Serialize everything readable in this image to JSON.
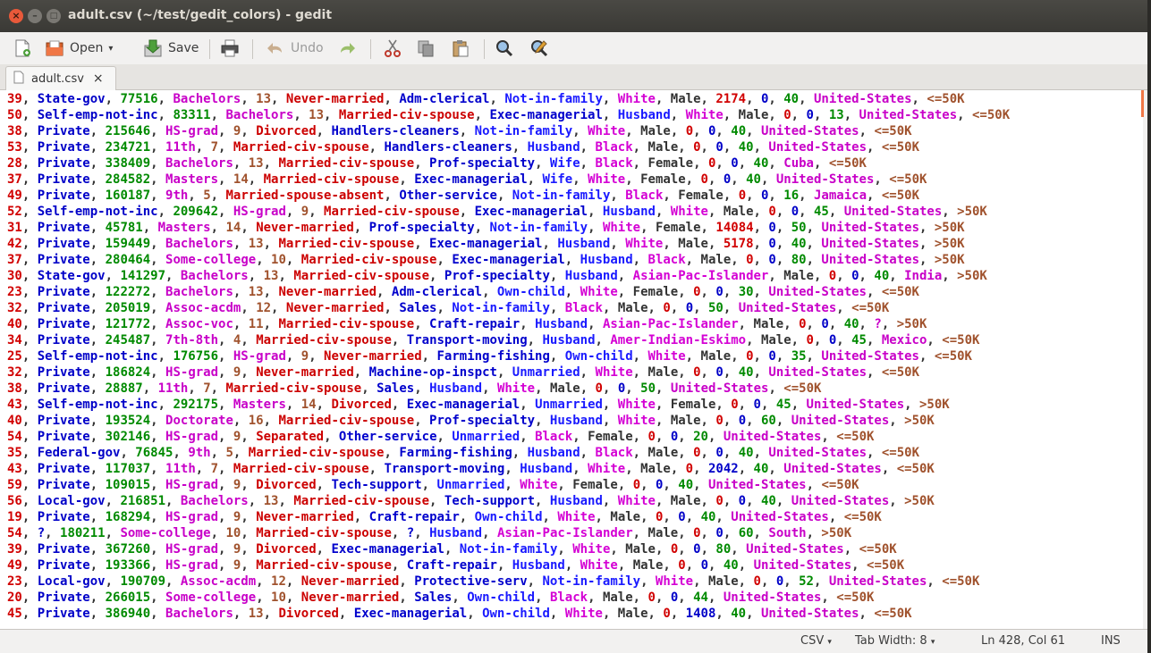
{
  "window": {
    "title": "adult.csv (~/test/gedit_colors) - gedit"
  },
  "toolbar": {
    "open_label": "Open",
    "save_label": "Save",
    "undo_label": "Undo"
  },
  "tabs": [
    {
      "label": "adult.csv"
    }
  ],
  "status": {
    "language": "CSV",
    "tab_width": "Tab Width: 8",
    "position": "Ln 428, Col 61",
    "mode": "INS"
  },
  "colors": {
    "c0": "#d10000",
    "c1": "#0000c8",
    "c2": "#008a00",
    "c3": "#c800c8",
    "c4": "#a0522d",
    "c5": "#cc0000",
    "c6": "#0000cc",
    "c7": "#1a1aff",
    "c8": "#d400d4",
    "c9": "#333333"
  },
  "lines": [
    "39, State-gov, 77516, Bachelors, 13, Never-married, Adm-clerical, Not-in-family, White, Male, 2174, 0, 40, United-States, <=50K",
    "50, Self-emp-not-inc, 83311, Bachelors, 13, Married-civ-spouse, Exec-managerial, Husband, White, Male, 0, 0, 13, United-States, <=50K",
    "38, Private, 215646, HS-grad, 9, Divorced, Handlers-cleaners, Not-in-family, White, Male, 0, 0, 40, United-States, <=50K",
    "53, Private, 234721, 11th, 7, Married-civ-spouse, Handlers-cleaners, Husband, Black, Male, 0, 0, 40, United-States, <=50K",
    "28, Private, 338409, Bachelors, 13, Married-civ-spouse, Prof-specialty, Wife, Black, Female, 0, 0, 40, Cuba, <=50K",
    "37, Private, 284582, Masters, 14, Married-civ-spouse, Exec-managerial, Wife, White, Female, 0, 0, 40, United-States, <=50K",
    "49, Private, 160187, 9th, 5, Married-spouse-absent, Other-service, Not-in-family, Black, Female, 0, 0, 16, Jamaica, <=50K",
    "52, Self-emp-not-inc, 209642, HS-grad, 9, Married-civ-spouse, Exec-managerial, Husband, White, Male, 0, 0, 45, United-States, >50K",
    "31, Private, 45781, Masters, 14, Never-married, Prof-specialty, Not-in-family, White, Female, 14084, 0, 50, United-States, >50K",
    "42, Private, 159449, Bachelors, 13, Married-civ-spouse, Exec-managerial, Husband, White, Male, 5178, 0, 40, United-States, >50K",
    "37, Private, 280464, Some-college, 10, Married-civ-spouse, Exec-managerial, Husband, Black, Male, 0, 0, 80, United-States, >50K",
    "30, State-gov, 141297, Bachelors, 13, Married-civ-spouse, Prof-specialty, Husband, Asian-Pac-Islander, Male, 0, 0, 40, India, >50K",
    "23, Private, 122272, Bachelors, 13, Never-married, Adm-clerical, Own-child, White, Female, 0, 0, 30, United-States, <=50K",
    "32, Private, 205019, Assoc-acdm, 12, Never-married, Sales, Not-in-family, Black, Male, 0, 0, 50, United-States, <=50K",
    "40, Private, 121772, Assoc-voc, 11, Married-civ-spouse, Craft-repair, Husband, Asian-Pac-Islander, Male, 0, 0, 40, ?, >50K",
    "34, Private, 245487, 7th-8th, 4, Married-civ-spouse, Transport-moving, Husband, Amer-Indian-Eskimo, Male, 0, 0, 45, Mexico, <=50K",
    "25, Self-emp-not-inc, 176756, HS-grad, 9, Never-married, Farming-fishing, Own-child, White, Male, 0, 0, 35, United-States, <=50K",
    "32, Private, 186824, HS-grad, 9, Never-married, Machine-op-inspct, Unmarried, White, Male, 0, 0, 40, United-States, <=50K",
    "38, Private, 28887, 11th, 7, Married-civ-spouse, Sales, Husband, White, Male, 0, 0, 50, United-States, <=50K",
    "43, Self-emp-not-inc, 292175, Masters, 14, Divorced, Exec-managerial, Unmarried, White, Female, 0, 0, 45, United-States, >50K",
    "40, Private, 193524, Doctorate, 16, Married-civ-spouse, Prof-specialty, Husband, White, Male, 0, 0, 60, United-States, >50K",
    "54, Private, 302146, HS-grad, 9, Separated, Other-service, Unmarried, Black, Female, 0, 0, 20, United-States, <=50K",
    "35, Federal-gov, 76845, 9th, 5, Married-civ-spouse, Farming-fishing, Husband, Black, Male, 0, 0, 40, United-States, <=50K",
    "43, Private, 117037, 11th, 7, Married-civ-spouse, Transport-moving, Husband, White, Male, 0, 2042, 40, United-States, <=50K",
    "59, Private, 109015, HS-grad, 9, Divorced, Tech-support, Unmarried, White, Female, 0, 0, 40, United-States, <=50K",
    "56, Local-gov, 216851, Bachelors, 13, Married-civ-spouse, Tech-support, Husband, White, Male, 0, 0, 40, United-States, >50K",
    "19, Private, 168294, HS-grad, 9, Never-married, Craft-repair, Own-child, White, Male, 0, 0, 40, United-States, <=50K",
    "54, ?, 180211, Some-college, 10, Married-civ-spouse, ?, Husband, Asian-Pac-Islander, Male, 0, 0, 60, South, >50K",
    "39, Private, 367260, HS-grad, 9, Divorced, Exec-managerial, Not-in-family, White, Male, 0, 0, 80, United-States, <=50K",
    "49, Private, 193366, HS-grad, 9, Married-civ-spouse, Craft-repair, Husband, White, Male, 0, 0, 40, United-States, <=50K",
    "23, Local-gov, 190709, Assoc-acdm, 12, Never-married, Protective-serv, Not-in-family, White, Male, 0, 0, 52, United-States, <=50K",
    "20, Private, 266015, Some-college, 10, Never-married, Sales, Own-child, Black, Male, 0, 0, 44, United-States, <=50K",
    "45, Private, 386940, Bachelors, 13, Divorced, Exec-managerial, Own-child, White, Male, 0, 1408, 40, United-States, <=50K"
  ]
}
